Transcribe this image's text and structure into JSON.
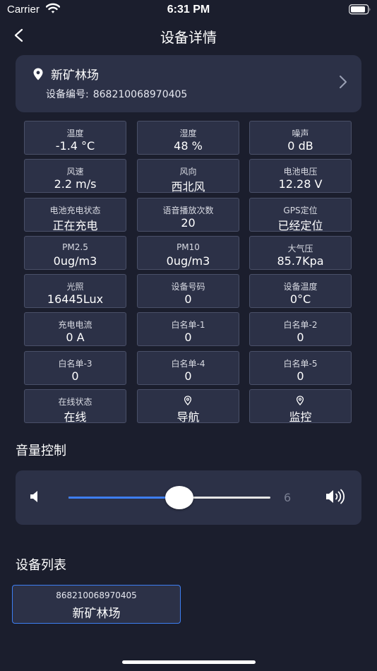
{
  "status_bar": {
    "carrier": "Carrier",
    "time": "6:31 PM"
  },
  "nav": {
    "title": "设备详情"
  },
  "location": {
    "name": "新矿林场",
    "code_label": "设备编号:",
    "code": "868210068970405"
  },
  "metrics": [
    {
      "label": "温度",
      "value": "-1.4 °C"
    },
    {
      "label": "湿度",
      "value": "48 %"
    },
    {
      "label": "噪声",
      "value": "0 dB"
    },
    {
      "label": "风速",
      "value": "2.2 m/s"
    },
    {
      "label": "风向",
      "value": "西北风"
    },
    {
      "label": "电池电压",
      "value": "12.28 V"
    },
    {
      "label": "电池充电状态",
      "value": "正在充电"
    },
    {
      "label": "语音播放次数",
      "value": "20"
    },
    {
      "label": "GPS定位",
      "value": "已经定位"
    },
    {
      "label": "PM2.5",
      "value": "0ug/m3"
    },
    {
      "label": "PM10",
      "value": "0ug/m3"
    },
    {
      "label": "大气压",
      "value": "85.7Kpa"
    },
    {
      "label": "光照",
      "value": "16445Lux"
    },
    {
      "label": "设备号码",
      "value": "0"
    },
    {
      "label": "设备温度",
      "value": "0°C"
    },
    {
      "label": "充电电流",
      "value": "0 A"
    },
    {
      "label": "白名单-1",
      "value": "0"
    },
    {
      "label": "白名单-2",
      "value": "0"
    },
    {
      "label": "白名单-3",
      "value": "0"
    },
    {
      "label": "白名单-4",
      "value": "0"
    },
    {
      "label": "白名单-5",
      "value": "0"
    },
    {
      "label": "在线状态",
      "value": "在线"
    }
  ],
  "actions": [
    {
      "icon": "location-pin-icon",
      "label": "导航"
    },
    {
      "icon": "location-pin-icon",
      "label": "监控"
    }
  ],
  "volume": {
    "title": "音量控制",
    "value": "6",
    "level_fraction": 0.55,
    "accent": "#3d7ef2"
  },
  "device_list": {
    "title": "设备列表",
    "items": [
      {
        "code": "868210068970405",
        "name": "新矿林场"
      }
    ]
  }
}
